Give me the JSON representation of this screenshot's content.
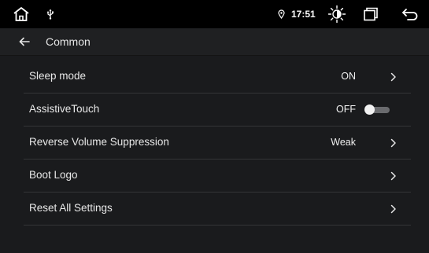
{
  "status_bar": {
    "time": "17:51",
    "icons": {
      "home": "home-icon",
      "usb": "usb-icon",
      "location": "location-pin-icon",
      "brightness": "brightness-icon",
      "recents": "recent-apps-icon",
      "back": "back-icon"
    }
  },
  "header": {
    "title": "Common",
    "back_icon": "arrow-left-icon"
  },
  "settings": {
    "items": [
      {
        "label": "Sleep mode",
        "value": "ON",
        "control": "chevron"
      },
      {
        "label": "AssistiveTouch",
        "value": "OFF",
        "control": "toggle",
        "toggle_on": false
      },
      {
        "label": "Reverse Volume Suppression",
        "value": "Weak",
        "control": "chevron"
      },
      {
        "label": "Boot Logo",
        "value": "",
        "control": "chevron"
      },
      {
        "label": "Reset All Settings",
        "value": "",
        "control": "chevron"
      }
    ]
  },
  "colors": {
    "background": "#1a1b1d",
    "status_bar": "#000000",
    "title_bar": "#1f2022",
    "divider": "#343538",
    "text": "#e8e8e8",
    "toggle_track_off": "#6a6b6e",
    "toggle_thumb": "#f2f2f2"
  }
}
